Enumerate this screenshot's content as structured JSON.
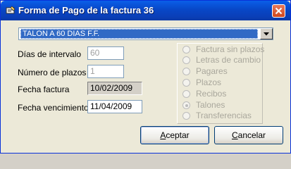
{
  "window": {
    "title": "Forma de Pago de la factura 36",
    "icon": "payment-icon"
  },
  "payment_type": {
    "selected": "TALON A 60 DIAS F.F."
  },
  "form": {
    "interval_label": "Días de intervalo",
    "interval_value": "60",
    "installments_label": "Número de plazos",
    "installments_value": "1",
    "invoice_date_label": "Fecha factura",
    "invoice_date_value": "10/02/2009",
    "due_date_label": "Fecha vencimiento",
    "due_date_value": "11/04/2009"
  },
  "options": [
    {
      "label": "Factura sin plazos",
      "checked": false
    },
    {
      "label": "Letras de cambio",
      "checked": false
    },
    {
      "label": "Pagares",
      "checked": false
    },
    {
      "label": "Plazos",
      "checked": false
    },
    {
      "label": "Recibos",
      "checked": false
    },
    {
      "label": "Talones",
      "checked": true
    },
    {
      "label": "Transferencias",
      "checked": false
    }
  ],
  "buttons": {
    "accept_first": "A",
    "accept_rest": "ceptar",
    "cancel_first": "C",
    "cancel_rest": "ancelar"
  }
}
